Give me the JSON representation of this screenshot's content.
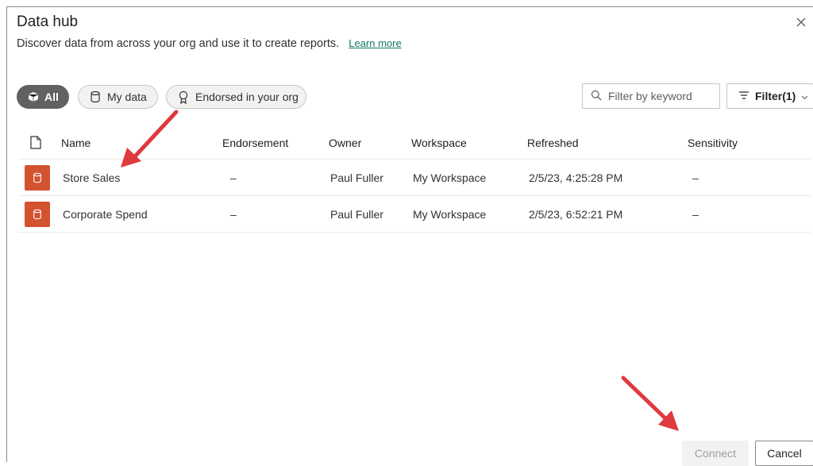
{
  "dialog": {
    "title": "Data hub",
    "subtitle": "Discover data from across your org and use it to create reports.",
    "learn_more": "Learn more",
    "close_icon": "close-icon"
  },
  "filters": {
    "all": "All",
    "my_data": "My data",
    "endorsed": "Endorsed in your org",
    "search_placeholder": "Filter by keyword",
    "filter_button": "Filter(1)"
  },
  "table": {
    "columns": [
      "Name",
      "Endorsement",
      "Owner",
      "Workspace",
      "Refreshed",
      "Sensitivity"
    ],
    "rows": [
      {
        "name": "Store Sales",
        "endorsement": "–",
        "owner": "Paul Fuller",
        "workspace": "My Workspace",
        "refreshed": "2/5/23, 4:25:28 PM",
        "sensitivity": "–"
      },
      {
        "name": "Corporate Spend",
        "endorsement": "–",
        "owner": "Paul Fuller",
        "workspace": "My Workspace",
        "refreshed": "2/5/23, 6:52:21 PM",
        "sensitivity": "–"
      }
    ]
  },
  "footer": {
    "connect": "Connect",
    "cancel": "Cancel"
  },
  "colors": {
    "dataset_icon": "#d35230",
    "arrow": "#e0393e",
    "link": "#117865"
  }
}
